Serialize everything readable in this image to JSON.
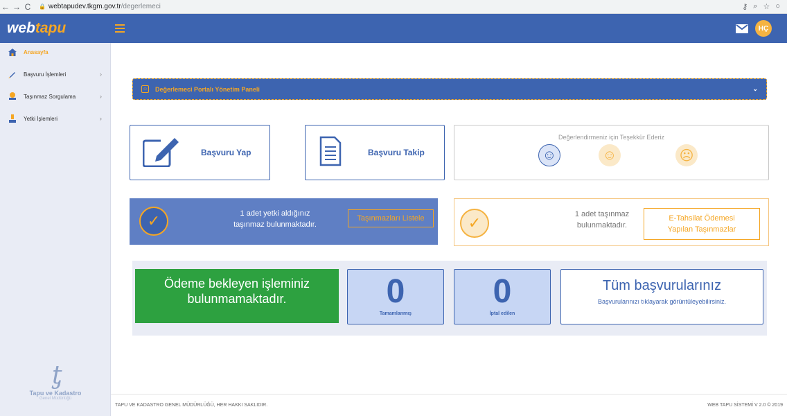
{
  "browser": {
    "url_host": "webtapudev.tkgm.gov.tr",
    "url_path": "/degerlemeci"
  },
  "header": {
    "logo_prefix": "web",
    "logo_suffix": "tapu",
    "avatar_initials": "HÇ"
  },
  "sidebar": {
    "items": [
      {
        "label": "Anasayfa",
        "icon": "home-icon"
      },
      {
        "label": "Başvuru İşlemleri",
        "icon": "pen-icon"
      },
      {
        "label": "Taşınmaz Sorgulama",
        "icon": "map-pin-icon"
      },
      {
        "label": "Yetki İşlemleri",
        "icon": "user-icon"
      }
    ],
    "logo_name": "Tapu ve Kadastro",
    "logo_sub": "Genel Müdürlüğü"
  },
  "panel": {
    "title": "Değerlemeci Portalı Yönetim Paneli"
  },
  "cards": {
    "apply_label": "Başvuru Yap",
    "track_label": "Başvuru Takip",
    "rate_title": "Değerlendirmeniz için Teşekkür Ederiz"
  },
  "stats": {
    "authorized_text_1": "1 adet yetki aldığınız",
    "authorized_text_2": "taşınmaz bulunmaktadır.",
    "authorized_button": "Taşınmazları Listele",
    "paid_text_1": "1 adet taşınmaz",
    "paid_text_2": "bulunmaktadır.",
    "paid_button_1": "E-Tahsilat Ödemesi",
    "paid_button_2": "Yapılan Taşınmazlar"
  },
  "summary": {
    "pending_1": "Ödeme bekleyen işleminiz",
    "pending_2": "bulunmamaktadır.",
    "completed_count": "0",
    "completed_label": "Tamamlanmış",
    "cancelled_count": "0",
    "cancelled_label": "İptal edilen",
    "all_title": "Tüm başvurularınız",
    "all_sub": "Başvurularınızı tıklayarak görüntüleyebilirsiniz."
  },
  "footer": {
    "left": "TAPU VE KADASTRO GENEL MÜDÜRLÜĞÜ, HER HAKKI SAKLIDIR.",
    "right": "WEB TAPU SİSTEMİ V 2.0 © 2019"
  },
  "colors": {
    "brand_blue": "#3d64b0",
    "accent_orange": "#f5a623",
    "success_green": "#2da140"
  }
}
